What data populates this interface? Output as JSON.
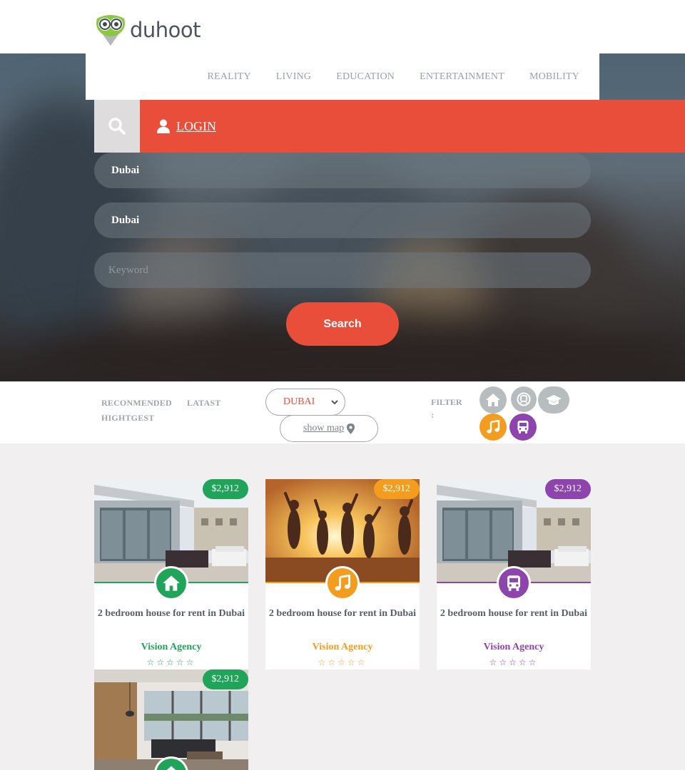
{
  "brand": {
    "name": "duhoot"
  },
  "nav": {
    "items": [
      "REALITY",
      "LIVING",
      "EDUCATION",
      "ENTERTAINMENT",
      "MOBILITY"
    ]
  },
  "login": {
    "label": "LOGIN"
  },
  "search_form": {
    "field1_value": "Dubai",
    "field2_value": "Dubai",
    "keyword_placeholder": "Keyword",
    "search_label": "Search"
  },
  "sort": {
    "recommended": "RECONMENDED",
    "latest": "LATAST",
    "highest": "HIGHTGEST"
  },
  "city_select": {
    "selected": "DUBAI"
  },
  "show_map": {
    "label": "show map"
  },
  "filter": {
    "label": "FILTER",
    "colon": ":",
    "icons": [
      "home-icon",
      "metro-icon",
      "graduation-cap-icon",
      "music-icon",
      "bus-icon"
    ]
  },
  "colors": {
    "accent": "#e84e3a",
    "green": "#1fa45a",
    "orange": "#f39c1d",
    "purple": "#8e44ad",
    "grey": "#b7bcbf"
  },
  "listings": [
    {
      "price": "$2,912",
      "title": "2 bedroom house for rent in Dubai",
      "agency": "Vision Agency",
      "category_icon": "home-icon",
      "color": "#1fa45a",
      "rating": 0
    },
    {
      "price": "$2,912",
      "title": "2 bedroom house for rent in Dubai",
      "agency": "Vision Agency",
      "category_icon": "music-icon",
      "color": "#f39c1d",
      "rating": 0
    },
    {
      "price": "$2,912",
      "title": "2 bedroom house for rent in Dubai",
      "agency": "Vision Agency",
      "category_icon": "bus-icon",
      "color": "#8e44ad",
      "rating": 0
    },
    {
      "price": "$2,912",
      "category_icon": "home-icon",
      "color": "#1fa45a"
    }
  ]
}
